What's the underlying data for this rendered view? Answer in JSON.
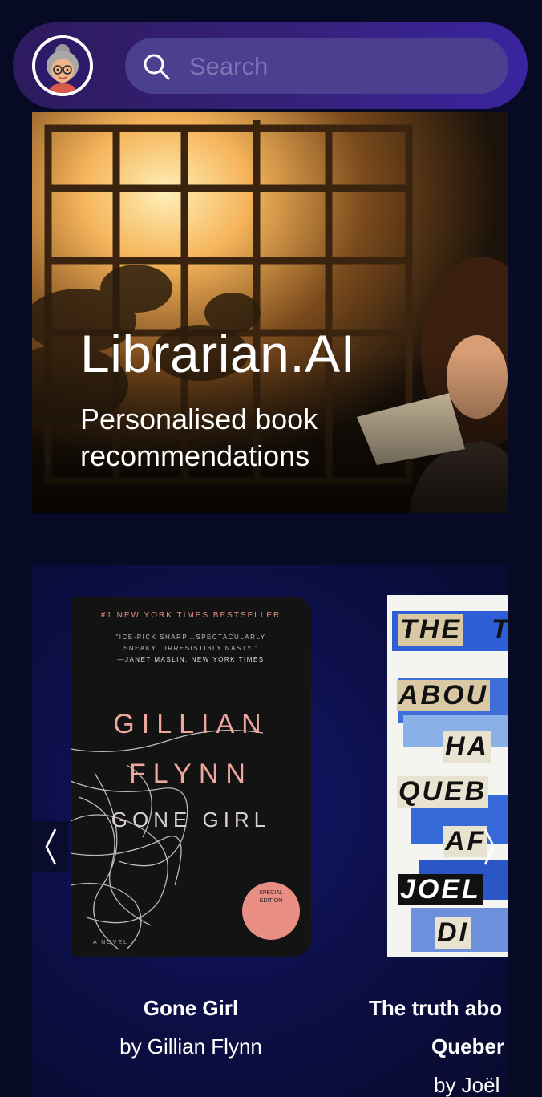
{
  "header": {
    "avatar_icon": "librarian-avatar-icon",
    "search": {
      "placeholder": "Search",
      "value": "",
      "icon": "search-icon"
    }
  },
  "hero": {
    "title": "Librarian.AI",
    "subtitle": "Personalised book recommendations"
  },
  "carousel": {
    "prev_icon": "chevron-left-icon",
    "next_icon": "chevron-right-icon",
    "books": [
      {
        "title": "Gone Girl",
        "author": "by Gillian Flynn",
        "cover": {
          "tagline": "#1 NEW YORK TIMES BESTSELLER",
          "blurb_1": "\"ICE-PICK SHARP...SPECTACULARLY",
          "blurb_2": "SNEAKY...IRRESISTIBLY NASTY.\"",
          "blurb_3": "—JANET MASLIN, NEW YORK TIMES",
          "author_first": "GILLIAN",
          "author_last": "FLYNN",
          "title": "GONE GIRL",
          "badge_1": "SPECIAL",
          "badge_2": "EDITION",
          "footer": "A NOVEL"
        }
      },
      {
        "title_line_1": "The truth abo",
        "title_line_2": "Queber",
        "author": "by Joël",
        "cover": {
          "words": [
            "THE",
            "T",
            "ABOU",
            "HA",
            "QUEB",
            "AF",
            "JOEL",
            "DI"
          ]
        }
      }
    ]
  }
}
